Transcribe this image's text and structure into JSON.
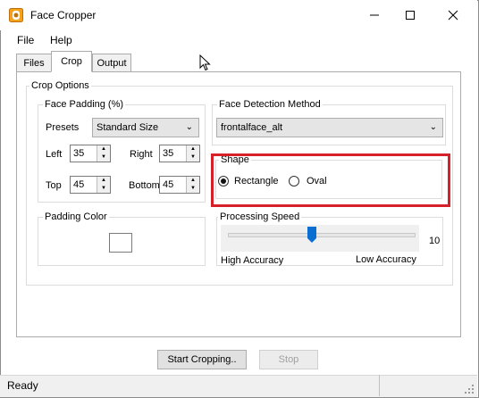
{
  "window": {
    "title": "Face Cropper"
  },
  "menu": {
    "file": "File",
    "help": "Help"
  },
  "tabs": [
    {
      "label": "Files"
    },
    {
      "label": "Crop"
    },
    {
      "label": "Output"
    }
  ],
  "crop_options": {
    "title": "Crop Options",
    "face_padding": {
      "title": "Face Padding (%)",
      "presets_label": "Presets",
      "preset_value": "Standard Size",
      "left_label": "Left",
      "left_value": "35",
      "right_label": "Right",
      "right_value": "35",
      "top_label": "Top",
      "top_value": "45",
      "bottom_label": "Bottom",
      "bottom_value": "45"
    },
    "face_detection": {
      "title": "Face Detection Method",
      "value": "frontalface_alt"
    },
    "shape": {
      "title": "Shape",
      "rectangle": "Rectangle",
      "oval": "Oval",
      "selected": "Rectangle"
    },
    "padding_color": {
      "title": "Padding Color",
      "color": "#ffffff"
    },
    "processing_speed": {
      "title": "Processing Speed",
      "value": "10",
      "level": 0.45,
      "high_label": "High Accuracy",
      "low_label": "Low Accuracy"
    }
  },
  "buttons": {
    "start": "Start Cropping..",
    "stop": "Stop"
  },
  "status": {
    "text": "Ready"
  },
  "colors": {
    "highlight": "#d6202a",
    "slider_thumb": "#0a6fd0"
  }
}
